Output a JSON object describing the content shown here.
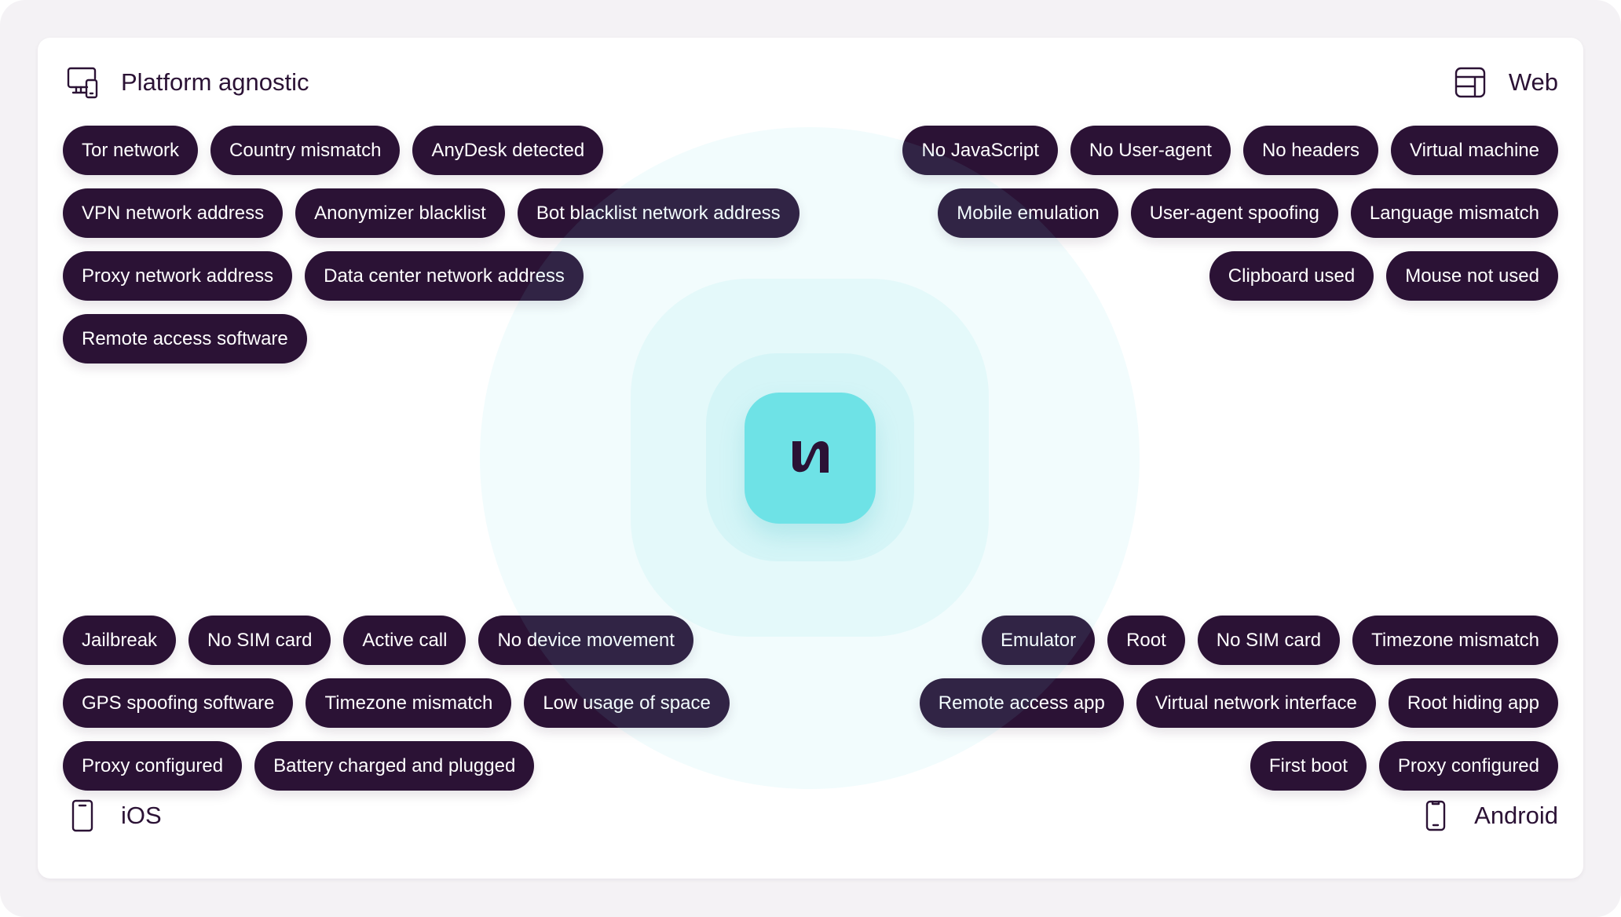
{
  "colors": {
    "chip_bg": "#2b1235",
    "chip_text": "#ffffff",
    "accent": "#6ee2e6",
    "text": "#2b1235",
    "page_bg": "#f4f2f5"
  },
  "center_logo": {
    "icon": "brand-logo-icon",
    "glyph": "n"
  },
  "sections": {
    "platform_agnostic": {
      "title": "Platform agnostic",
      "icon": "desktop-mobile-icon",
      "rows": [
        [
          "Tor network",
          "Country mismatch",
          "AnyDesk detected"
        ],
        [
          "VPN network address",
          "Anonymizer blacklist",
          "Bot blacklist network address"
        ],
        [
          "Proxy network address",
          "Data center network address"
        ],
        [
          "Remote access software"
        ]
      ]
    },
    "web": {
      "title": "Web",
      "icon": "browser-layout-icon",
      "rows": [
        [
          "No JavaScript",
          "No User-agent",
          "No headers",
          "Virtual machine"
        ],
        [
          "Mobile emulation",
          "User-agent spoofing",
          "Language mismatch"
        ],
        [
          "Clipboard used",
          "Mouse not used"
        ]
      ]
    },
    "ios": {
      "title": "iOS",
      "icon": "iphone-icon",
      "rows": [
        [
          "Jailbreak",
          "No SIM card",
          "Active call",
          "No device movement"
        ],
        [
          "GPS spoofing software",
          "Timezone mismatch",
          "Low usage of space"
        ],
        [
          "Proxy configured",
          "Battery charged and plugged"
        ]
      ]
    },
    "android": {
      "title": "Android",
      "icon": "android-phone-icon",
      "rows": [
        [
          "Emulator",
          "Root",
          "No SIM card",
          "Timezone mismatch"
        ],
        [
          "Remote access app",
          "Virtual network interface",
          "Root hiding app"
        ],
        [
          "First boot",
          "Proxy configured"
        ]
      ]
    }
  }
}
